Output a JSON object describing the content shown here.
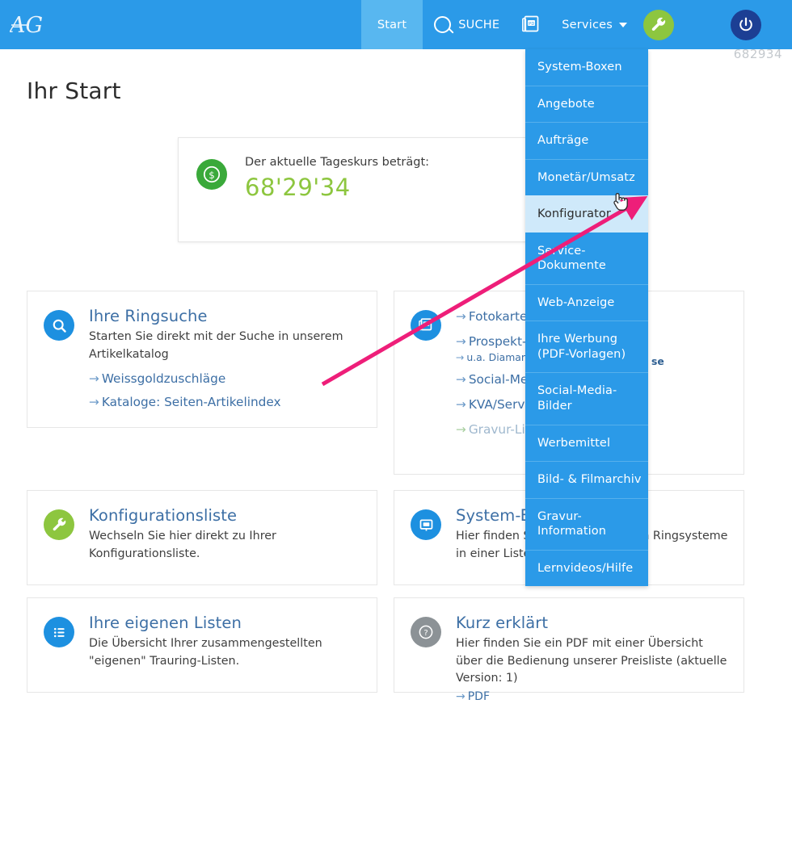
{
  "header": {
    "logo_text": "AG",
    "nav": [
      {
        "label": "Start",
        "name": "nav-start",
        "active": true
      },
      {
        "label": "SUCHE",
        "name": "nav-suche",
        "icon": "search-icon"
      },
      {
        "label": "",
        "name": "nav-pdf",
        "icon": "pdf-icon"
      },
      {
        "label": "Services",
        "name": "nav-services",
        "icon": "chevron-down-icon"
      }
    ],
    "wrench_button": "wrench-icon",
    "power_button": "power-icon",
    "watermark": "682934"
  },
  "page": {
    "title": "Ihr Start"
  },
  "kurs_card": {
    "icon": "dollar-coin-icon",
    "label": "Der aktuelle Tageskurs beträgt:",
    "value": "68'29'34",
    "value_color": "#8dc63f"
  },
  "services_menu": {
    "items": [
      {
        "label": "System-Boxen",
        "active": false
      },
      {
        "label": "Angebote",
        "active": false
      },
      {
        "label": "Aufträge",
        "active": false
      },
      {
        "label": "Monetär/Umsatz",
        "active": false
      },
      {
        "label": "Konfigurator",
        "active": true
      },
      {
        "label": "Service-\nDokumente",
        "active": false
      },
      {
        "label": "Web-Anzeige",
        "active": false
      },
      {
        "label": "Ihre Werbung\n(PDF-Vorlagen)",
        "active": false
      },
      {
        "label": "Social-Media-Bilder",
        "active": false
      },
      {
        "label": "Werbemittel",
        "active": false
      },
      {
        "label": "Bild- & Filmarchiv",
        "active": false
      },
      {
        "label": "Gravur-Information",
        "active": false
      },
      {
        "label": "Lernvideos/Hilfe",
        "active": false
      }
    ]
  },
  "cards": {
    "ringsuche": {
      "icon": "search-circle-icon",
      "title": "Ihre Ringsuche",
      "desc": "Starten Sie direkt mit der Suche in unserem Artikelkatalog",
      "links": [
        "Weissgoldzuschläge",
        "Kataloge: Seiten-Artikelindex"
      ]
    },
    "pdf": {
      "icon": "pdf-circle-icon",
      "links": [
        "Fotokarten",
        "Prospekt-u",
        "u.a. Diamant-",
        "Social-Med",
        "KVA/Service",
        "Gravur-List"
      ],
      "fragment_right": "se"
    },
    "konfigurationsliste": {
      "icon": "wrench-circle-icon",
      "title": "Konfigurationsliste",
      "desc": "Wechseln Sie hier direkt zu Ihrer Konfigurationsliste."
    },
    "system_boxen": {
      "icon": "monitor-circle-icon",
      "title": "System-Boxen",
      "desc": "Hier finden Sie unsere bekannten Ringsysteme in einer Liste dargestellt."
    },
    "eigene_listen": {
      "icon": "list-circle-icon",
      "title": "Ihre eigenen Listen",
      "desc": "Die Übersicht Ihrer zusammengestellten \"eigenen\" Trauring-Listen."
    },
    "kurz_erklaert": {
      "icon": "question-circle-icon",
      "title": "Kurz erklärt",
      "desc": "Hier finden Sie ein PDF mit einer Übersicht über die Bedienung unserer Preisliste (aktuelle Version: 1)",
      "link": "PDF"
    }
  },
  "annotation": {
    "arrow_color": "#ee1e79",
    "cursor": "pointing-hand-cursor"
  }
}
